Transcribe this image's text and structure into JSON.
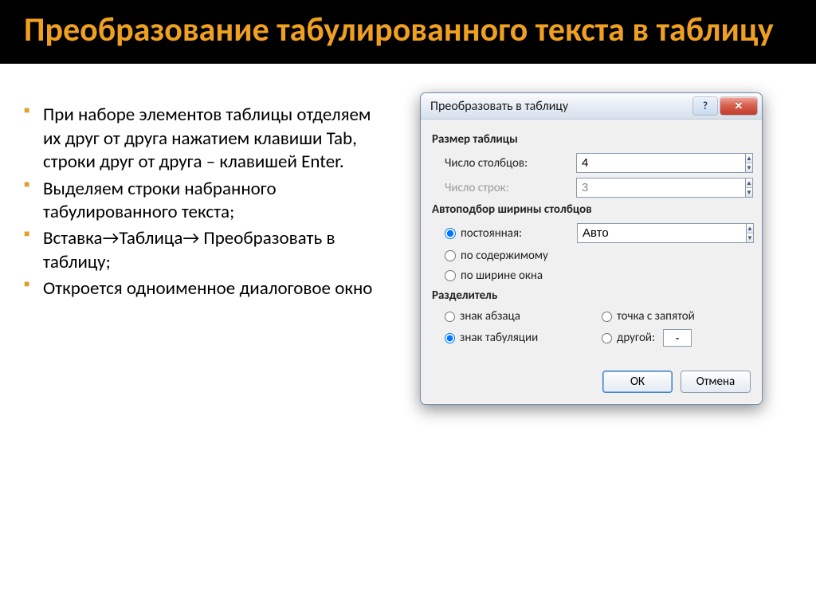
{
  "slide": {
    "title": "Преобразование табулированного текста в таблицу"
  },
  "bullets": [
    "При наборе элементов таблицы отделяем их друг от друга нажатием клавиши Tab, строки друг от друга – клавишей Enter.",
    "Выделяем строки набранного табулированного текста;",
    "Вставка→Таблица→ Преобразовать в таблицу;",
    "Откроется одноименное диалоговое окно"
  ],
  "dialog": {
    "title": "Преобразовать в таблицу",
    "help_icon": "?",
    "close_icon": "✕",
    "size_group": "Размер таблицы",
    "cols_label": "Число столбцов:",
    "cols_value": "4",
    "rows_label": "Число строк:",
    "rows_value": "3",
    "autofit_group": "Автоподбор ширины столбцов",
    "opt_fixed": "постоянная:",
    "fixed_value": "Авто",
    "opt_content": "по содержимому",
    "opt_window": "по ширине окна",
    "sep_group": "Разделитель",
    "sep_para": "знак абзаца",
    "sep_semi": "точка с запятой",
    "sep_tab": "знак табуляции",
    "sep_other": "другой:",
    "sep_other_value": "-",
    "ok": "ОК",
    "cancel": "Отмена"
  }
}
